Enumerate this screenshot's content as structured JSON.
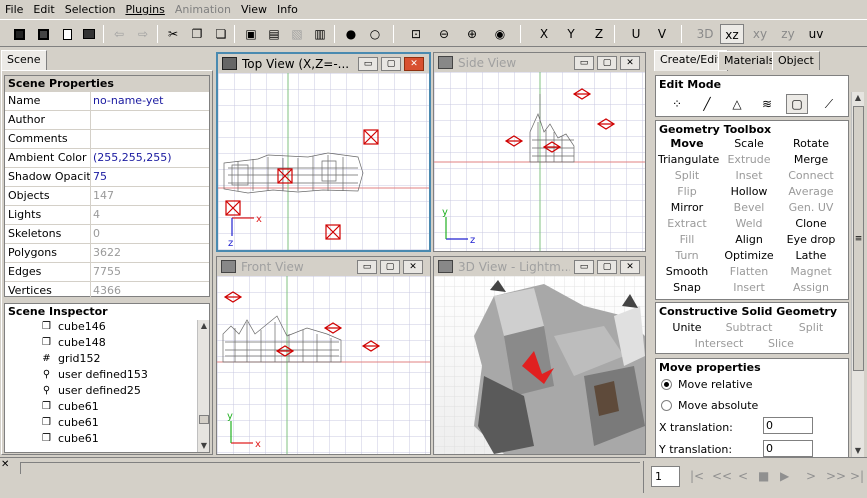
{
  "menu": {
    "file": "File",
    "edit": "Edit",
    "selection": "Selection",
    "plugins": "Plugins",
    "animation": "Animation",
    "view": "View",
    "info": "Info"
  },
  "toolbar": {
    "x": "X",
    "y": "Y",
    "z": "Z",
    "u": "U",
    "v": "V",
    "v3d": "3D",
    "xz": "xz",
    "xy": "xy",
    "zy": "zy",
    "uv": "uv"
  },
  "left_tab": "Scene",
  "scene_properties": {
    "title": "Scene Properties",
    "rows": [
      {
        "name": "Name",
        "value": "no-name-yet"
      },
      {
        "name": "Author",
        "value": ""
      },
      {
        "name": "Comments",
        "value": ""
      },
      {
        "name": "Ambient Color",
        "value": "(255,255,255)"
      },
      {
        "name": "Shadow Opacity",
        "value": "75"
      },
      {
        "name": "Objects",
        "value": "147"
      },
      {
        "name": "Lights",
        "value": "4"
      },
      {
        "name": "Skeletons",
        "value": "0"
      },
      {
        "name": "Polygons",
        "value": "3622"
      },
      {
        "name": "Edges",
        "value": "7755"
      },
      {
        "name": "Vertices",
        "value": "4366"
      }
    ]
  },
  "scene_inspector": {
    "title": "Scene Inspector",
    "items": [
      {
        "label": "cube146",
        "icon": "cube-icon"
      },
      {
        "label": "cube148",
        "icon": "cube-icon"
      },
      {
        "label": "grid152",
        "icon": "grid-icon"
      },
      {
        "label": "user defined153",
        "icon": "user-defined-icon"
      },
      {
        "label": "user defined25",
        "icon": "user-defined-icon"
      },
      {
        "label": "cube61",
        "icon": "cube-icon"
      },
      {
        "label": "cube61",
        "icon": "cube-icon"
      },
      {
        "label": "cube61",
        "icon": "cube-icon"
      }
    ]
  },
  "viewports": {
    "top": "Top View (X,Z=-...",
    "side": "Side View",
    "front": "Front View",
    "v3d": "3D View - Lightm..."
  },
  "axes": {
    "x": "x",
    "y": "y",
    "z": "z"
  },
  "right_tabs": {
    "create_edit": "Create/Edit",
    "materials": "Materials",
    "object": "Object"
  },
  "edit_mode": {
    "title": "Edit Mode"
  },
  "geometry_toolbox": {
    "title": "Geometry Toolbox",
    "buttons": [
      [
        "Move",
        "Scale",
        "Rotate"
      ],
      [
        "Triangulate",
        "Extrude",
        "Merge"
      ],
      [
        "Split",
        "Inset",
        "Connect"
      ],
      [
        "Flip",
        "Hollow",
        "Average"
      ],
      [
        "Mirror",
        "Bevel",
        "Gen. UV"
      ],
      [
        "Extract",
        "Weld",
        "Clone"
      ],
      [
        "Fill",
        "Align",
        "Eye drop"
      ],
      [
        "Turn",
        "Optimize",
        "Lathe"
      ],
      [
        "Smooth",
        "Flatten",
        "Magnet"
      ],
      [
        "Snap",
        "Insert",
        "Assign"
      ]
    ],
    "enabled": [
      [
        true,
        true,
        true
      ],
      [
        true,
        false,
        true
      ],
      [
        false,
        false,
        false
      ],
      [
        false,
        true,
        false
      ],
      [
        true,
        false,
        false
      ],
      [
        false,
        false,
        true
      ],
      [
        false,
        true,
        true
      ],
      [
        false,
        true,
        true
      ],
      [
        true,
        false,
        false
      ],
      [
        true,
        false,
        false
      ]
    ]
  },
  "csg": {
    "title": "Constructive Solid Geometry",
    "unite": "Unite",
    "subtract": "Subtract",
    "split": "Split",
    "intersect": "Intersect",
    "slice": "Slice"
  },
  "move_properties": {
    "title": "Move properties",
    "relative": "Move relative",
    "absolute": "Move absolute",
    "x_label": "X translation:",
    "x_value": "0",
    "y_label": "Y translation:",
    "y_value": "0"
  },
  "timeline": {
    "frame": "1"
  },
  "colors": {
    "accent": "#4a8ab0",
    "selection_red": "#d00000",
    "grid": "#c8c8e0",
    "axis_red": "#e02020",
    "axis_blue": "#2020d0",
    "axis_green": "#20b020"
  }
}
